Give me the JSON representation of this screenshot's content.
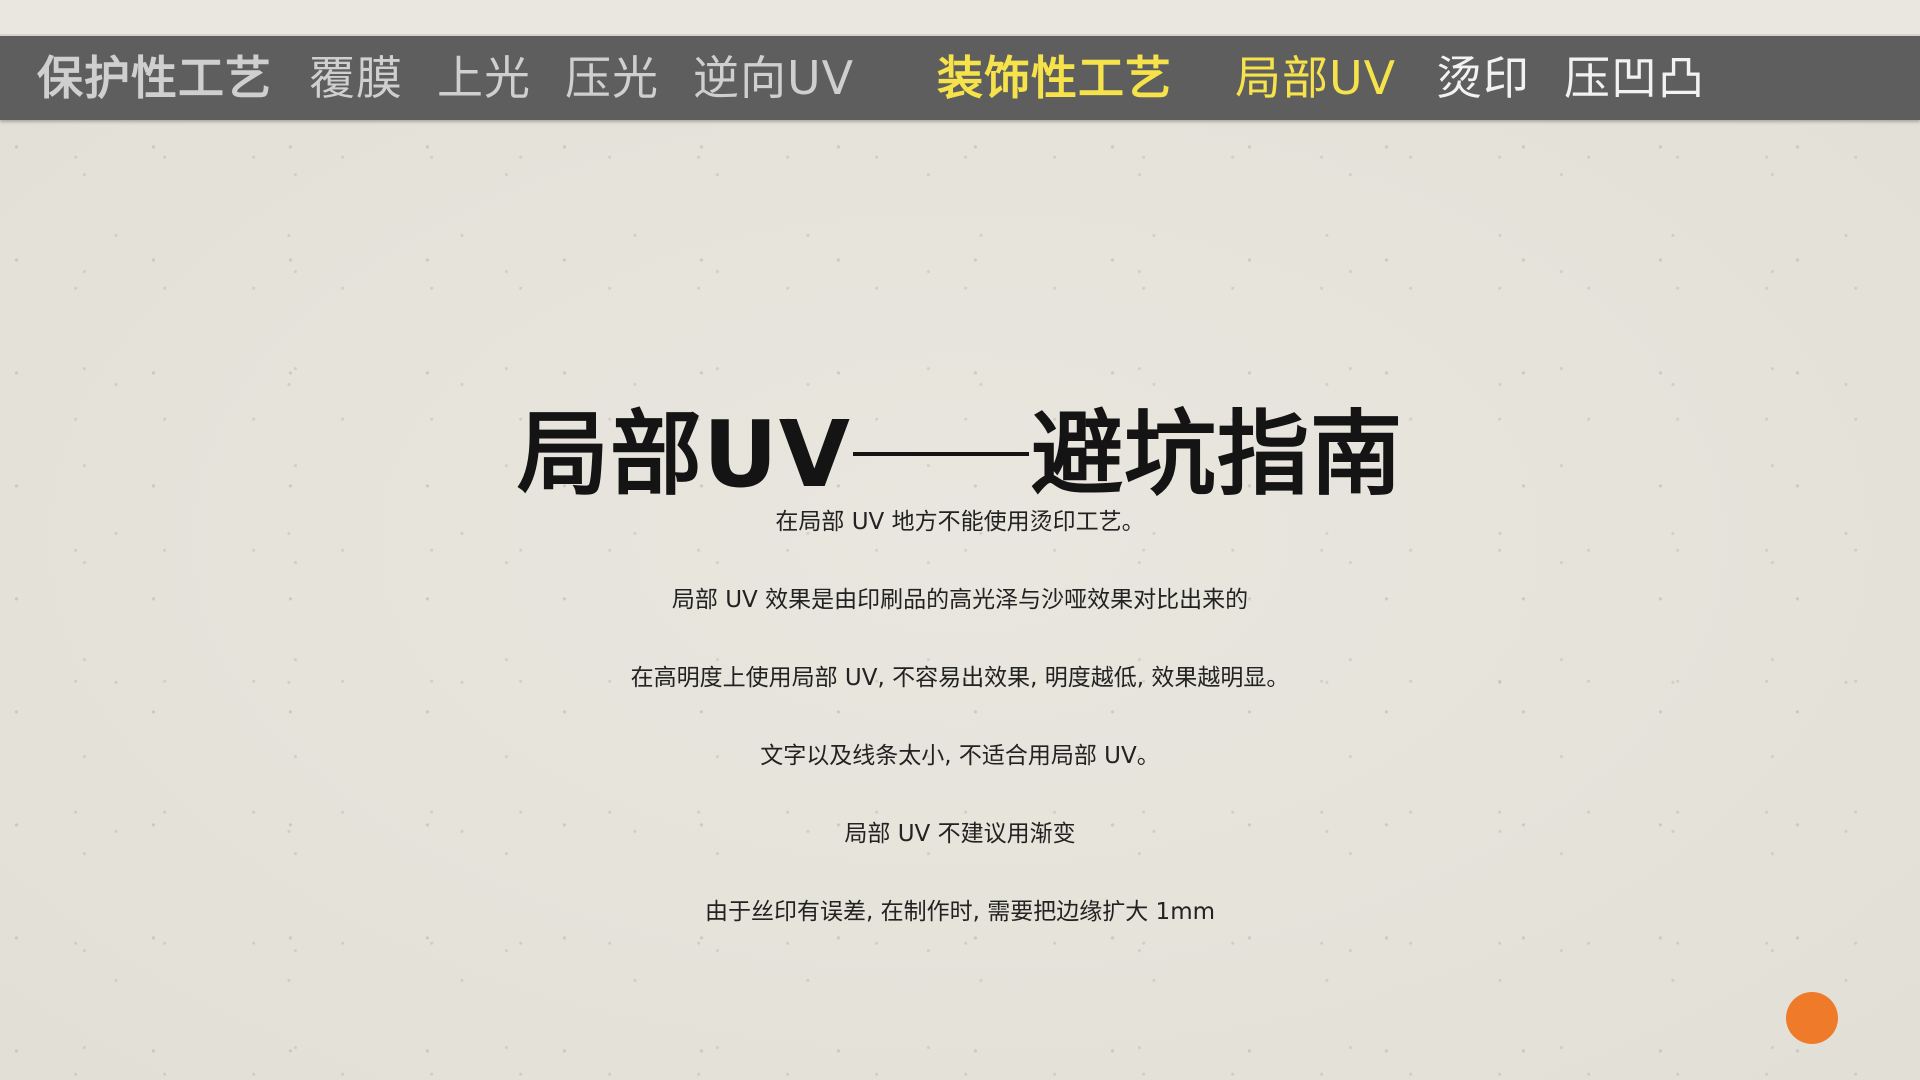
{
  "nav": {
    "protective_heading": "保护性工艺",
    "lamination": "覆膜",
    "gloss": "上光",
    "calender": "压光",
    "reverse_uv": "逆向UV",
    "decorative_heading": "装饰性工艺",
    "spot_uv": "局部UV",
    "hot_stamp": "烫印",
    "emboss": "压凹凸"
  },
  "title": {
    "left": "局部UV",
    "right": "避坑指南"
  },
  "tips": [
    "在局部 UV 地方不能使用烫印工艺。",
    "局部 UV 效果是由印刷品的高光泽与沙哑效果对比出来的",
    "在高明度上使用局部 UV, 不容易出效果, 明度越低, 效果越明显。",
    "文字以及线条太小, 不适合用局部 UV。",
    "局部 UV 不建议用渐变",
    "由于丝印有误差, 在制作时, 需要把边缘扩大 1mm"
  ],
  "colors": {
    "navbar_bg": "#5e5e5e",
    "active_yellow": "#f6e24a",
    "fab_orange": "#ef7b2a"
  }
}
